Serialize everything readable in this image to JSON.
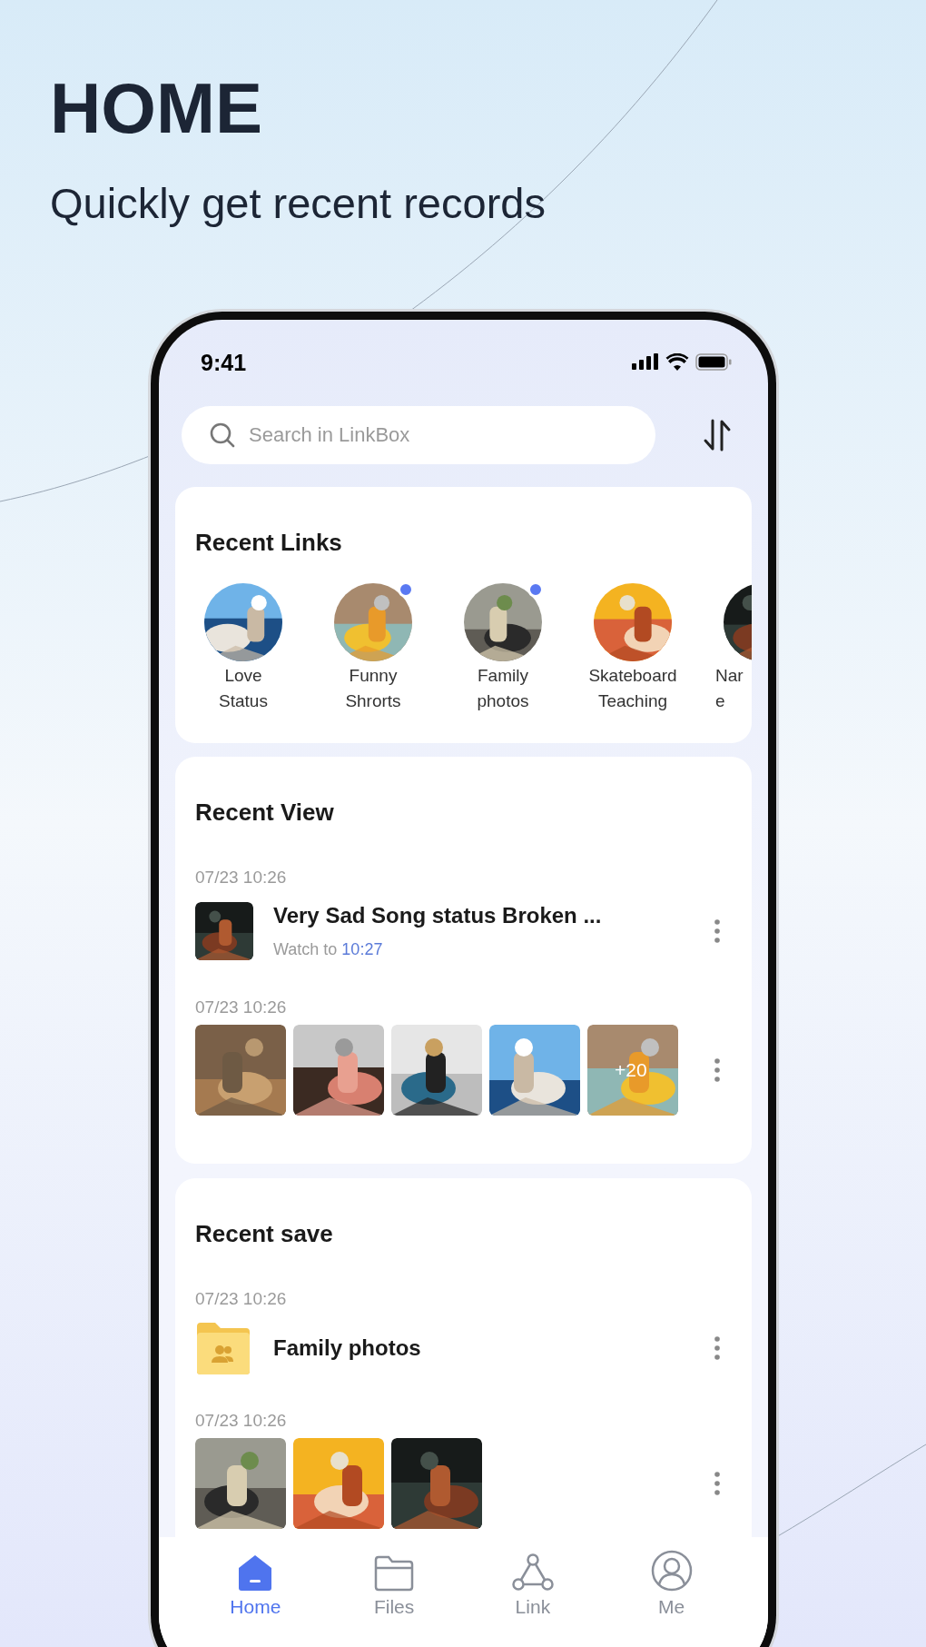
{
  "header": {
    "title": "HOME",
    "subtitle": "Quickly get recent records"
  },
  "status_bar": {
    "time": "9:41"
  },
  "search": {
    "placeholder": "Search in LinkBox"
  },
  "recent_links": {
    "title": "Recent Links",
    "items": [
      {
        "lines": [
          "Love",
          "Status"
        ],
        "unread": false,
        "cut": false
      },
      {
        "lines": [
          "Funny",
          "Shrorts"
        ],
        "unread": true,
        "cut": false
      },
      {
        "lines": [
          "Family",
          "photos"
        ],
        "unread": true,
        "cut": false
      },
      {
        "lines": [
          "Skateboard",
          "Teaching"
        ],
        "unread": false,
        "cut": false
      },
      {
        "lines": [
          "Nar",
          "e"
        ],
        "unread": false,
        "cut": true
      }
    ]
  },
  "recent_view": {
    "title": "Recent View",
    "entries": [
      {
        "kind": "video",
        "time": "07/23 10:26",
        "title": "Very Sad Song status Broken ...",
        "progress_label": "Watch to",
        "progress_time": "10:27"
      },
      {
        "kind": "photos",
        "time": "07/23 10:26",
        "photos": [
          {
            "kind": "picture"
          },
          {
            "kind": "picture"
          },
          {
            "kind": "picture"
          },
          {
            "kind": "picture"
          },
          {
            "kind": "picture",
            "more": "+20"
          }
        ]
      }
    ]
  },
  "recent_save": {
    "title": "Recent save",
    "entries": [
      {
        "kind": "folder",
        "time": "07/23 10:26",
        "title": "Family photos"
      },
      {
        "kind": "photos",
        "time": "07/23 10:26",
        "photos": [
          {
            "kind": "picture"
          },
          {
            "kind": "picture"
          },
          {
            "kind": "picture"
          }
        ]
      }
    ]
  },
  "tab_bar": [
    {
      "label": "Home",
      "selected": true
    },
    {
      "label": "Files",
      "selected": false
    },
    {
      "label": "Link",
      "selected": false
    },
    {
      "label": "Me",
      "selected": false
    }
  ]
}
